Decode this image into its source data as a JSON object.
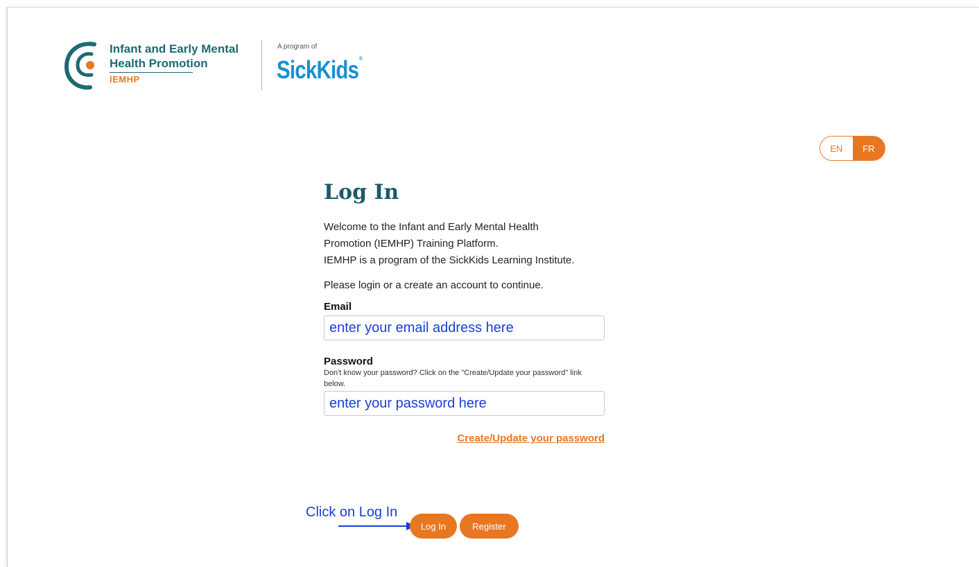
{
  "header": {
    "logo_line1": "Infant and Early Mental",
    "logo_line2": "Health Promotion",
    "logo_abbr": "IEMHP",
    "program_of": "A program of",
    "partner_name": "SickKids",
    "partner_reg": "®"
  },
  "language": {
    "options": [
      "EN",
      "FR"
    ],
    "selected": "FR"
  },
  "login": {
    "title": "Log In",
    "intro_line1": "Welcome to the Infant and Early Mental Health Promotion (IEMHP) Training Platform.",
    "intro_line2": "IEMHP is a program of the SickKids Learning Institute.",
    "prompt": "Please login or a create an account to continue.",
    "email_label": "Email",
    "email_placeholder": "enter your email address here",
    "password_label": "Password",
    "password_hint": "Don't know your password? Click on the \"Create/Update your password\" link below.",
    "password_placeholder": "enter your password here",
    "forgot_link": "Create/Update your password",
    "login_button": "Log In",
    "register_button": "Register"
  },
  "annotation": {
    "text": "Click on Log In"
  },
  "colors": {
    "brand_teal": "#1c5a66",
    "accent_orange": "#e87722",
    "sickkids_blue": "#1a8fd0",
    "annotation_blue": "#1a3dd9"
  }
}
